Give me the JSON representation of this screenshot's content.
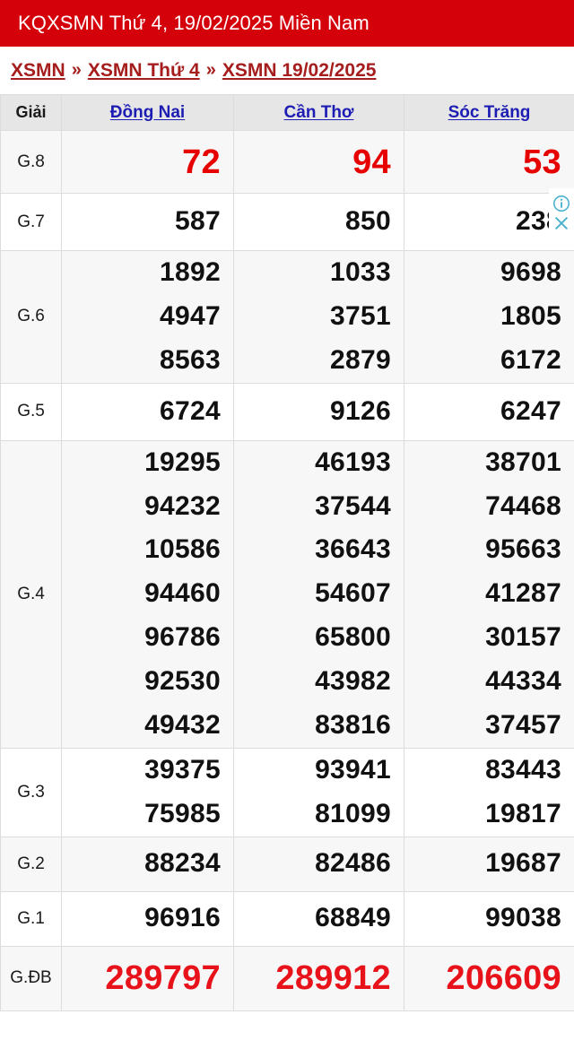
{
  "header": {
    "title": "KQXSMN Thứ 4, 19/02/2025 Miền Nam",
    "bg_color": "#d4000a"
  },
  "breadcrumb": {
    "separator": "»",
    "items": [
      {
        "label": "XSMN"
      },
      {
        "label": "XSMN Thứ 4"
      },
      {
        "label": "XSMN 19/02/2025"
      }
    ],
    "link_color": "#a51d1d"
  },
  "corner_icons": {
    "info_label": "info-icon",
    "close_label": "close-icon",
    "color": "#4cb3cf"
  },
  "table": {
    "prize_column_header": "Giải",
    "provinces": [
      "Đồng Nai",
      "Cần Thơ",
      "Sóc Trăng"
    ],
    "province_link_color": "#1d1db4",
    "highlight_color": "#e60000",
    "rows": [
      {
        "prize": "G.8",
        "cells": [
          [
            "72"
          ],
          [
            "94"
          ],
          [
            "53"
          ]
        ]
      },
      {
        "prize": "G.7",
        "cells": [
          [
            "587"
          ],
          [
            "850"
          ],
          [
            "238"
          ]
        ]
      },
      {
        "prize": "G.6",
        "cells": [
          [
            "1892",
            "4947",
            "8563"
          ],
          [
            "1033",
            "3751",
            "2879"
          ],
          [
            "9698",
            "1805",
            "6172"
          ]
        ]
      },
      {
        "prize": "G.5",
        "cells": [
          [
            "6724"
          ],
          [
            "9126"
          ],
          [
            "6247"
          ]
        ]
      },
      {
        "prize": "G.4",
        "cells": [
          [
            "19295",
            "94232",
            "10586",
            "94460",
            "96786",
            "92530",
            "49432"
          ],
          [
            "46193",
            "37544",
            "36643",
            "54607",
            "65800",
            "43982",
            "83816"
          ],
          [
            "38701",
            "74468",
            "95663",
            "41287",
            "30157",
            "44334",
            "37457"
          ]
        ]
      },
      {
        "prize": "G.3",
        "cells": [
          [
            "39375",
            "75985"
          ],
          [
            "93941",
            "81099"
          ],
          [
            "83443",
            "19817"
          ]
        ]
      },
      {
        "prize": "G.2",
        "cells": [
          [
            "88234"
          ],
          [
            "82486"
          ],
          [
            "19687"
          ]
        ]
      },
      {
        "prize": "G.1",
        "cells": [
          [
            "96916"
          ],
          [
            "68849"
          ],
          [
            "99038"
          ]
        ]
      },
      {
        "prize": "G.ĐB",
        "cells": [
          [
            "289797"
          ],
          [
            "289912"
          ],
          [
            "206609"
          ]
        ]
      }
    ]
  }
}
